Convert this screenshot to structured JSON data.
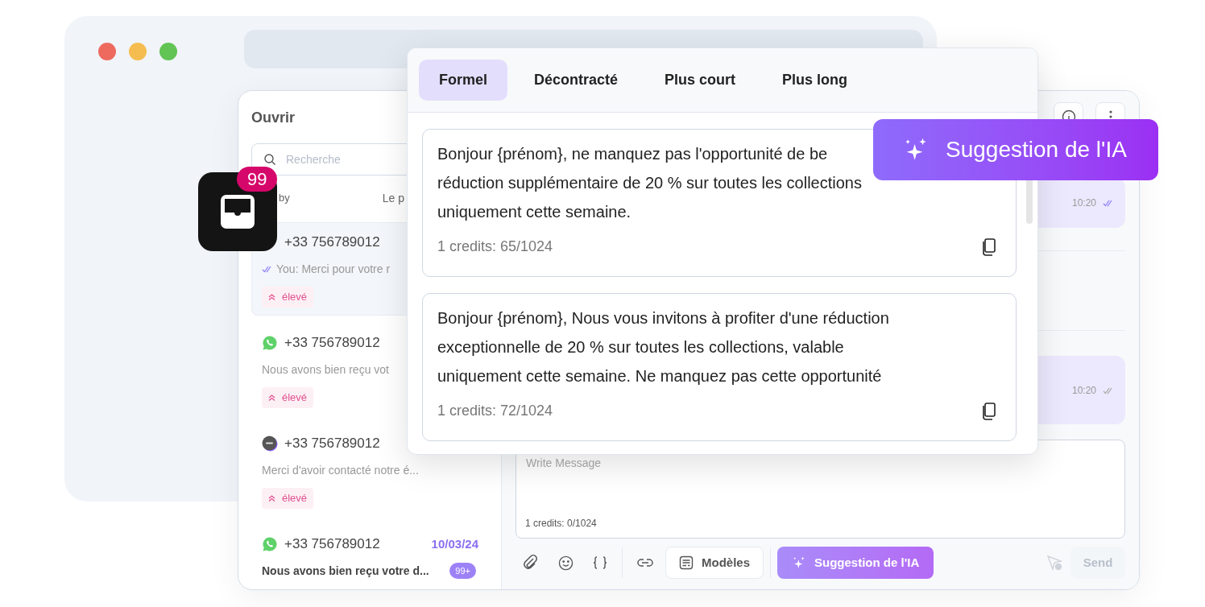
{
  "browser": {
    "traffic_lights": [
      {
        "color": "#ee6a5f"
      },
      {
        "color": "#f5bd4f"
      },
      {
        "color": "#61c454"
      }
    ]
  },
  "inbox_app_icon": {
    "badge": "99"
  },
  "conversations": {
    "title": "Ouvrir",
    "search": {
      "placeholder": "Recherche"
    },
    "sort_label": "by",
    "column_label": "Le p",
    "items": [
      {
        "phone": "+33 756789012",
        "preview": "You: Merci pour votre r",
        "read": true,
        "unread": false,
        "priority": "élevé",
        "selected": true
      },
      {
        "kind": "whatsapp",
        "phone": "+33 756789012",
        "preview": "Nous avons bien reçu vot",
        "unread": false,
        "priority": "élevé",
        "selected": false
      },
      {
        "kind": "sms",
        "phone": "+33 756789012",
        "preview": "Merci d'avoir contacté notre é...",
        "unread": false,
        "priority": "élevé",
        "selected": false
      },
      {
        "kind": "whatsapp",
        "phone": "+33 756789012",
        "date": "10/03/24",
        "preview": "Nous avons bien reçu votre d...",
        "unread": true,
        "unread_count": "99+",
        "selected": false
      }
    ]
  },
  "chat": {
    "messages": [
      {
        "time": "10:20",
        "read": true
      },
      {
        "time": "10:20",
        "read": false
      }
    ]
  },
  "composer": {
    "placeholder": "Write Message",
    "credits": "1 credits: 0/1024",
    "templates_button": "Modèles",
    "ai_button": "Suggestion de l'IA",
    "send_button": {
      "label": "Send",
      "disabled": true
    }
  },
  "ai_popup": {
    "tabs": [
      {
        "label": "Formel",
        "selected": true
      },
      {
        "label": "Décontracté",
        "selected": false
      },
      {
        "label": "Plus court",
        "selected": false
      },
      {
        "label": "Plus long",
        "selected": false
      }
    ],
    "suggestions": [
      {
        "lines": [
          "Bonjour {prénom}, ne manquez pas l'opportunité de be",
          "réduction supplémentaire de 20 % sur toutes les collections",
          "uniquement cette semaine."
        ],
        "credits": "1 credits: 65/1024"
      },
      {
        "lines": [
          "Bonjour {prénom}, Nous vous invitons à profiter d'une réduction",
          "exceptionnelle de 20 % sur toutes les collections, valable",
          "uniquement cette semaine. Ne manquez pas cette opportunité"
        ],
        "credits": "1 credits: 72/1024"
      }
    ]
  },
  "ai_banner": {
    "label": "Suggestion de l'IA"
  }
}
